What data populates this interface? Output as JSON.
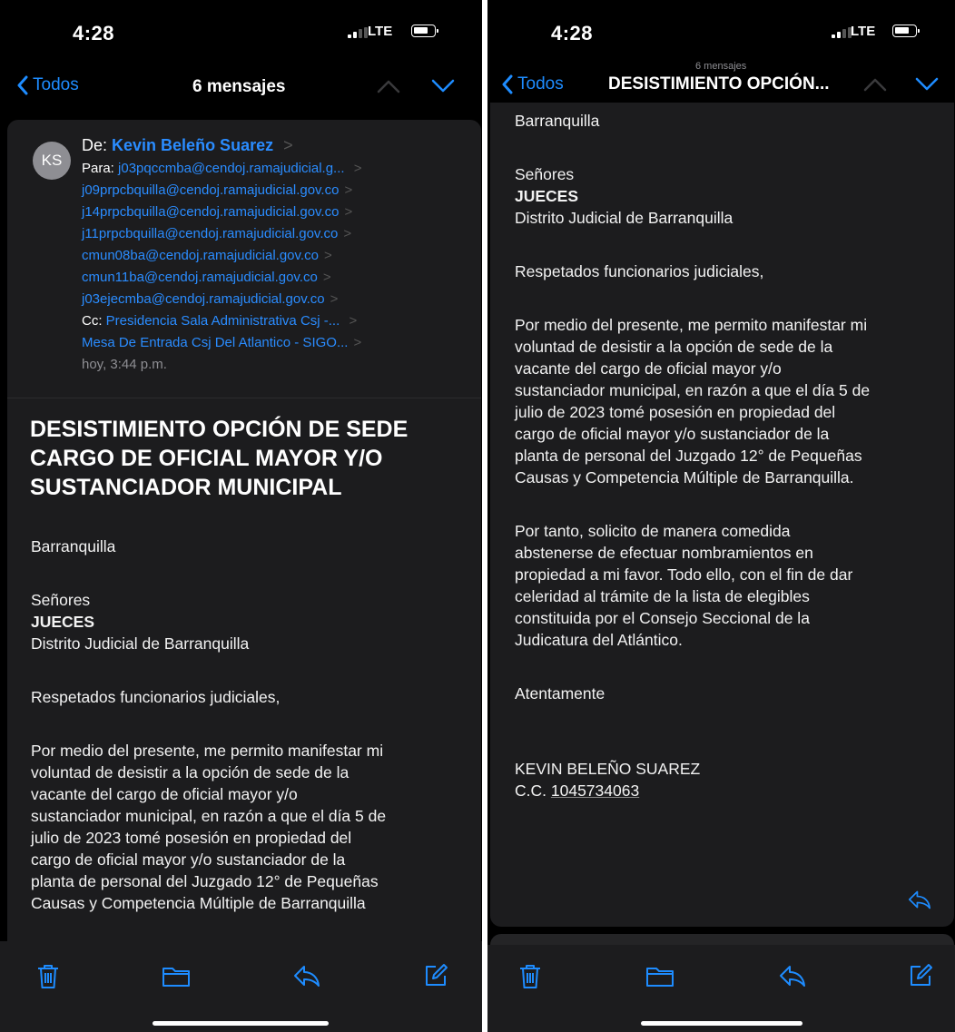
{
  "left": {
    "status": {
      "time": "4:28",
      "network": "LTE"
    },
    "nav": {
      "back_label": "Todos",
      "title": "6 mensajes"
    },
    "header": {
      "avatar_initials": "KS",
      "from_label": "De:",
      "from_name": "Kevin Beleño Suarez",
      "to_label": "Para:",
      "to_first": "j03pqccmba@cendoj.ramajudicial.g...",
      "to_list": [
        "j09prpcbquilla@cendoj.ramajudicial.gov.co",
        "j14prpcbquilla@cendoj.ramajudicial.gov.co",
        "j11prpcbquilla@cendoj.ramajudicial.gov.co",
        "cmun08ba@cendoj.ramajudicial.gov.co",
        "cmun11ba@cendoj.ramajudicial.gov.co",
        "j03ejecmba@cendoj.ramajudicial.gov.co"
      ],
      "cc_label": "Cc:",
      "cc_first": "Presidencia Sala Administrativa Csj -...",
      "cc_second": "Mesa De Entrada Csj Del Atlantico - SIGO...",
      "date": "hoy, 3:44 p.m."
    },
    "subject_lines": [
      "DESISTIMIENTO OPCIÓN DE SEDE",
      "CARGO DE OFICIAL MAYOR Y/O",
      "SUSTANCIADOR MUNICIPAL"
    ],
    "city": "Barranquilla",
    "salutation": "Señores",
    "recipient": "JUECES",
    "district": "Distrito Judicial de Barranquilla",
    "greeting": "Respetados funcionarios judiciales,",
    "paragraph1": [
      "Por medio del presente, me permito manifestar mi",
      "voluntad de desistir a la opción de sede de la",
      "vacante del cargo de oficial mayor y/o",
      "sustanciador municipal, en razón a que el día 5 de",
      "julio de 2023 tomé posesión en propiedad del",
      "cargo de oficial mayor y/o sustanciador de la",
      "planta de personal del Juzgado 12° de Pequeñas",
      "Causas y Competencia Múltiple de Barranquilla"
    ]
  },
  "right": {
    "status": {
      "time": "4:28",
      "network": "LTE"
    },
    "nav": {
      "back_label": "Todos",
      "count": "6 mensajes",
      "title": "DESISTIMIENTO OPCIÓN..."
    },
    "city": "Barranquilla",
    "salutation": "Señores",
    "recipient": "JUECES",
    "district": "Distrito Judicial de Barranquilla",
    "greeting": "Respetados funcionarios judiciales,",
    "paragraph1": [
      "Por medio del presente, me permito manifestar mi",
      "voluntad de desistir a la opción de sede de la",
      "vacante del cargo de oficial mayor y/o",
      "sustanciador municipal, en razón a que el día 5 de",
      "julio de 2023 tomé posesión en propiedad del",
      "cargo de oficial mayor y/o sustanciador de la",
      "planta de personal del Juzgado 12° de Pequeñas",
      "Causas y Competencia Múltiple de Barranquilla."
    ],
    "paragraph2": [
      "Por tanto, solicito de manera comedida",
      "abstenerse de efectuar nombramientos en",
      "propiedad a mi favor. Todo ello, con el fin de dar",
      "celeridad al trámite de la lista de elegibles",
      "constituida por el Consejo Seccional de la",
      "Judicatura del Atlántico."
    ],
    "closing": "Atentamente",
    "signature_name": "KEVIN BELEÑO SUAREZ",
    "id_label": "C.C.",
    "id_number": "1045734063"
  },
  "colors": {
    "accent": "#1e8cff",
    "card": "#1c1c1e",
    "background": "#000000"
  }
}
